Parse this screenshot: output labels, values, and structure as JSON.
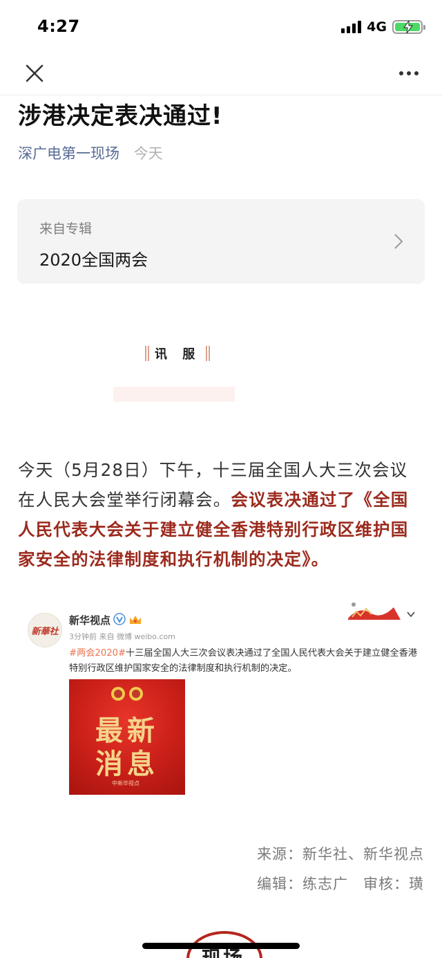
{
  "status": {
    "time": "4:27",
    "network": "4G"
  },
  "article": {
    "title": "涉港决定表决通过!",
    "source": "深广电第一现场",
    "date": "今天"
  },
  "album": {
    "label": "来自专辑",
    "name": "2020全国两会"
  },
  "brand": {
    "tag": "讯 服"
  },
  "body": {
    "plain": "今天（5月28日）下午，十三届全国人大三次会议在人民大会堂举行闭幕会。",
    "highlight": "会议表决通过了《全国人民代表大会关于建立健全香港特别行政区维护国家安全的法律制度和执行机制的决定》。"
  },
  "weibo": {
    "avatar_text": "新華社",
    "name": "新华视点",
    "time": "3分钟前 来自 微博 weibo.com",
    "tag": "#两会2020#",
    "text": "十三届全国人大三次会议表决通过了全国人民代表大会关于建立健全香港特别行政区维护国家安全的法律制度和执行机制的决定。",
    "image_line1": "最新",
    "image_line2": "消息",
    "image_footer": "中新华视点"
  },
  "credits": {
    "source": "来源：新华社、新华视点",
    "editor": "编辑：练志广",
    "reviewer": "审核：璜"
  },
  "footer": {
    "badge_text": "现场"
  },
  "colors": {
    "link": "#576b95",
    "highlight": "#9b2a1d",
    "weibo_tag": "#eb7350",
    "battery": "#4cd964"
  }
}
